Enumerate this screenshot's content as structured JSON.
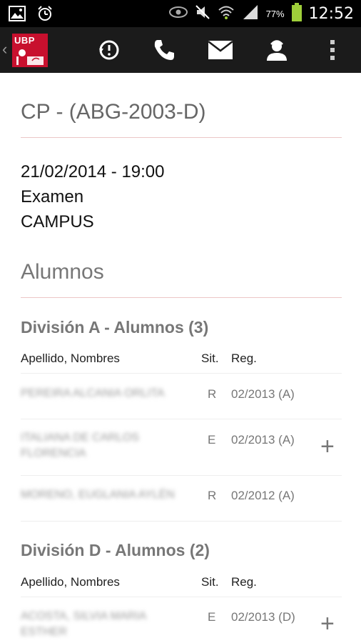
{
  "status_bar": {
    "battery": "77%",
    "time": "12:52"
  },
  "action_bar": {
    "logo_text": "UBP"
  },
  "page": {
    "title": "CP - (ABG-2003-D)",
    "datetime": "21/02/2014 - 19:00",
    "type": "Examen",
    "location": "CAMPUS",
    "students_section": "Alumnos"
  },
  "columns": {
    "name": "Apellido, Nombres",
    "sit": "Sit.",
    "reg": "Reg."
  },
  "divisions": [
    {
      "title": "División A - Alumnos (3)",
      "rows": [
        {
          "name": "PEREIRA ALCANIA ORLITA",
          "sit": "R",
          "reg": "02/2013 (A)"
        },
        {
          "name": "ITALIANA DE CARLOS FLORENCIA",
          "sit": "E",
          "reg": "02/2013 (A)"
        },
        {
          "name": "MORENO, EUGLANIA AYLÉN",
          "sit": "R",
          "reg": "02/2012 (A)"
        }
      ]
    },
    {
      "title": "División D - Alumnos (2)",
      "rows": [
        {
          "name": "ACOSTA, SILVIA MARIA ESTHER",
          "sit": "E",
          "reg": "02/2013 (D)"
        }
      ]
    }
  ]
}
